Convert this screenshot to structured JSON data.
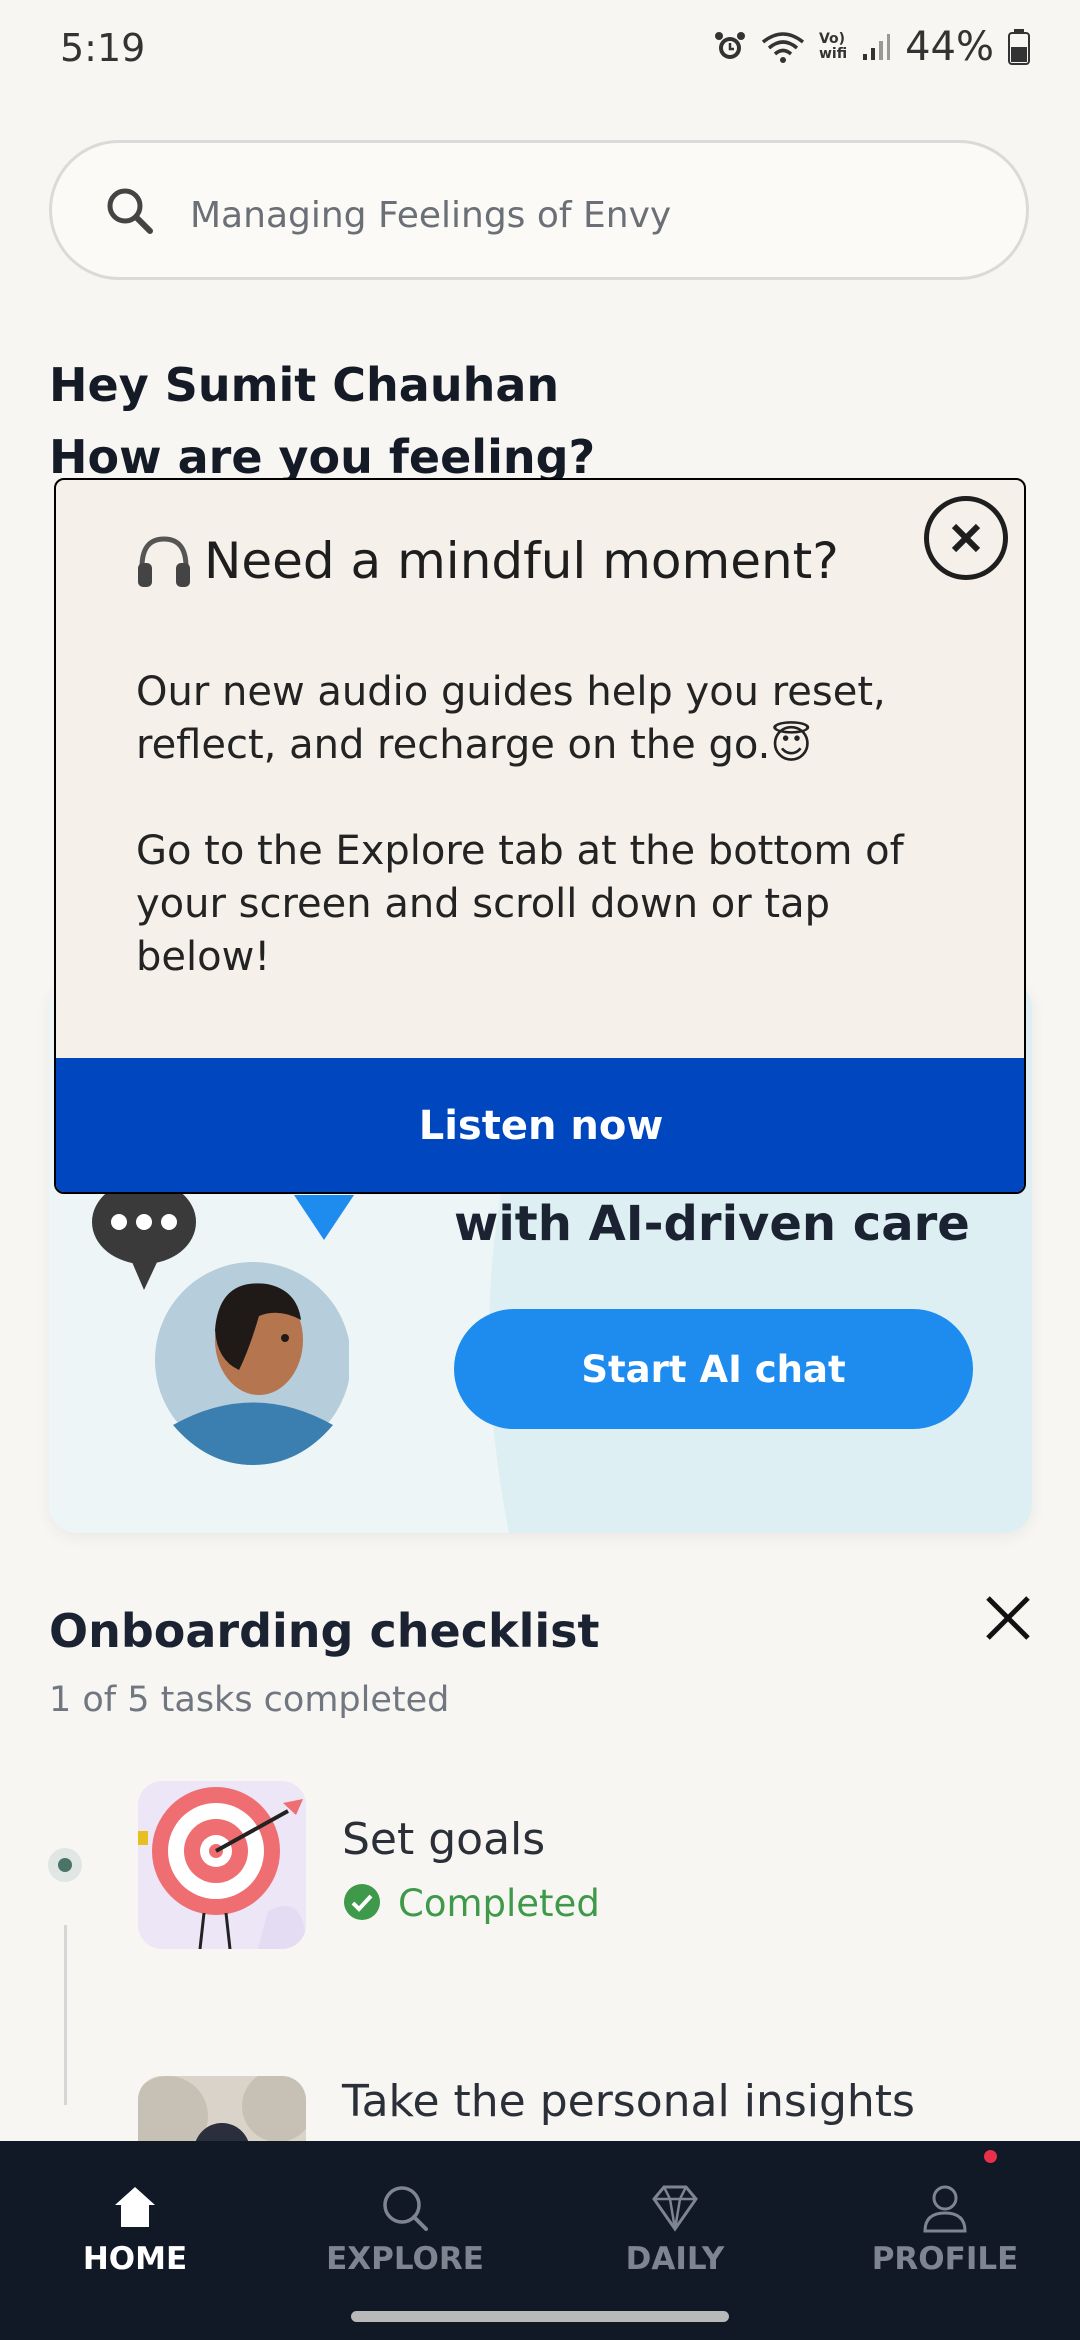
{
  "status": {
    "time": "5:19",
    "battery": "44%",
    "volte_top": "Vo)",
    "volte_bottom": "wifi"
  },
  "search": {
    "placeholder": "Managing Feelings of Envy"
  },
  "greeting": {
    "line1": "Hey Sumit Chauhan",
    "line2": "How are you feeling?"
  },
  "ai_card": {
    "title": "with AI-driven care",
    "button": "Start AI chat"
  },
  "modal": {
    "title": "Need a mindful moment?",
    "body1": "Our new audio guides help you reset, reflect, and recharge on the go.😇",
    "body2": "Go to the Explore tab at the bottom of your screen and scroll down or tap below!",
    "button": "Listen now"
  },
  "onboarding": {
    "title": "Onboarding checklist",
    "progress": "1 of 5 tasks completed",
    "tasks": [
      {
        "title": "Set goals",
        "status": "Completed"
      },
      {
        "title": "Take the personal insights"
      }
    ]
  },
  "nav": {
    "items": [
      {
        "label": "HOME",
        "active": true
      },
      {
        "label": "EXPLORE"
      },
      {
        "label": "DAILY"
      },
      {
        "label": "PROFILE"
      }
    ]
  },
  "colors": {
    "primary": "#0046BE",
    "accent": "#1E8BEF",
    "nav_bg": "#111826",
    "success": "#3E9A4A"
  }
}
